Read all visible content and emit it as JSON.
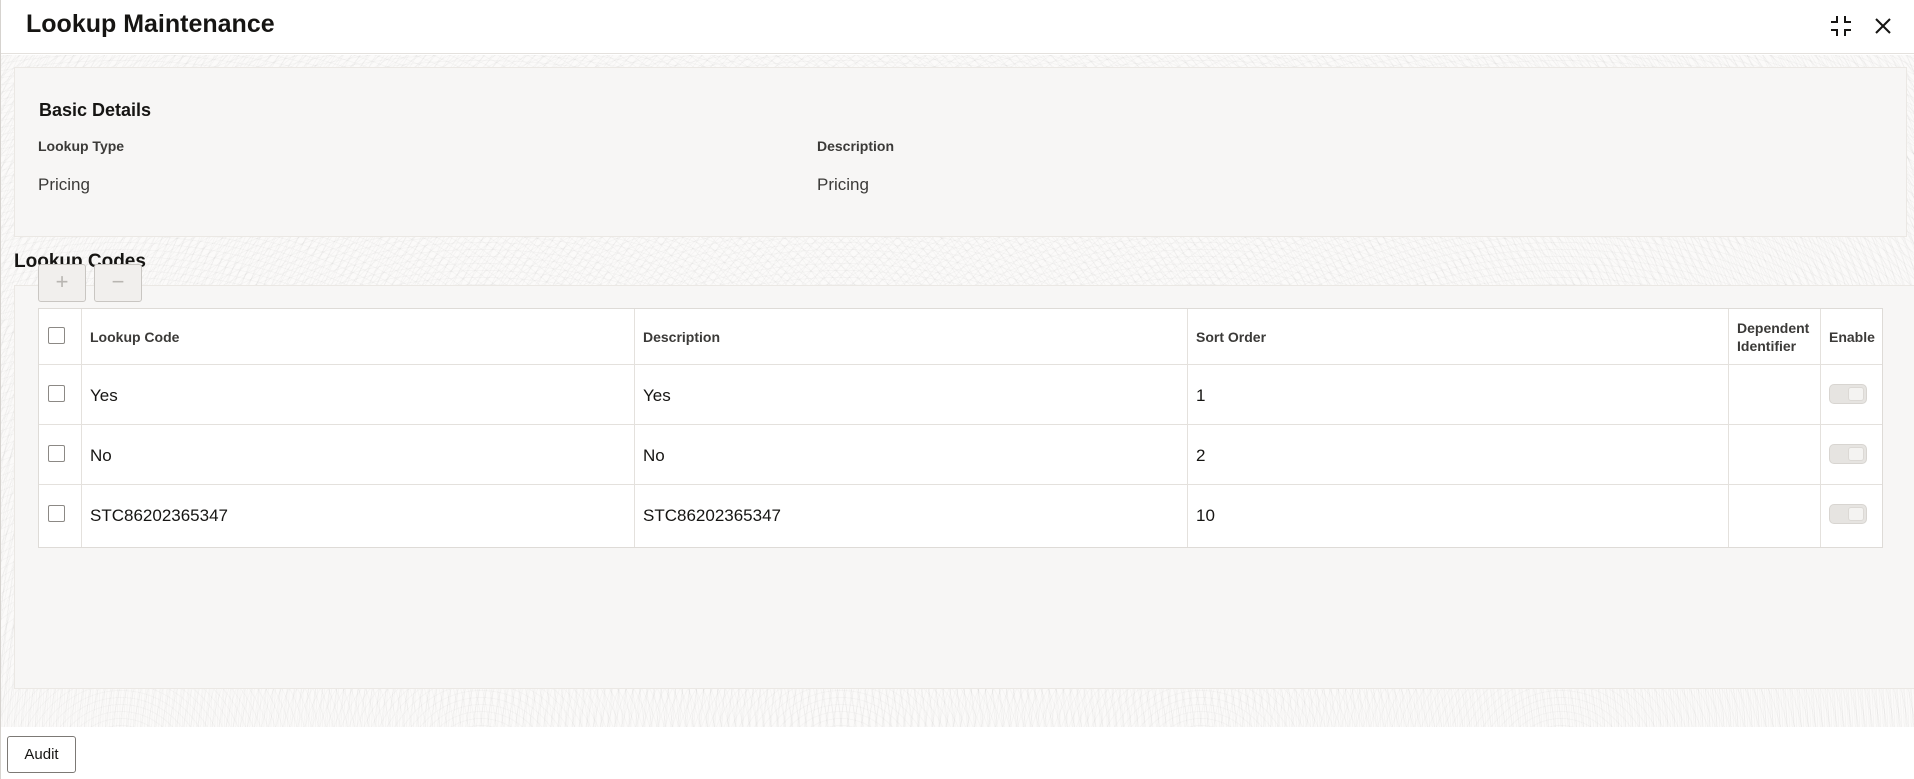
{
  "window": {
    "title": "Lookup Maintenance",
    "icons": [
      "minimize-icon",
      "close-icon"
    ]
  },
  "basic_details": {
    "heading": "Basic Details",
    "lookup_type_label": "Lookup Type",
    "lookup_type_value": "Pricing",
    "description_label": "Description",
    "description_value": "Pricing"
  },
  "lookup_codes": {
    "heading": "Lookup Codes",
    "add_label": "+",
    "remove_label": "−",
    "columns": [
      "Lookup Code",
      "Description",
      "Sort Order",
      "Dependent Identifier",
      "Enable"
    ],
    "rows": [
      {
        "code": "Yes",
        "description": "Yes",
        "sort_order": "1",
        "dependent_identifier": "",
        "enabled": false
      },
      {
        "code": "No",
        "description": "No",
        "sort_order": "2",
        "dependent_identifier": "",
        "enabled": false
      },
      {
        "code": "STC86202365347",
        "description": "STC86202365347",
        "sort_order": "10",
        "dependent_identifier": "",
        "enabled": false
      }
    ]
  },
  "footer": {
    "audit_label": "Audit"
  }
}
